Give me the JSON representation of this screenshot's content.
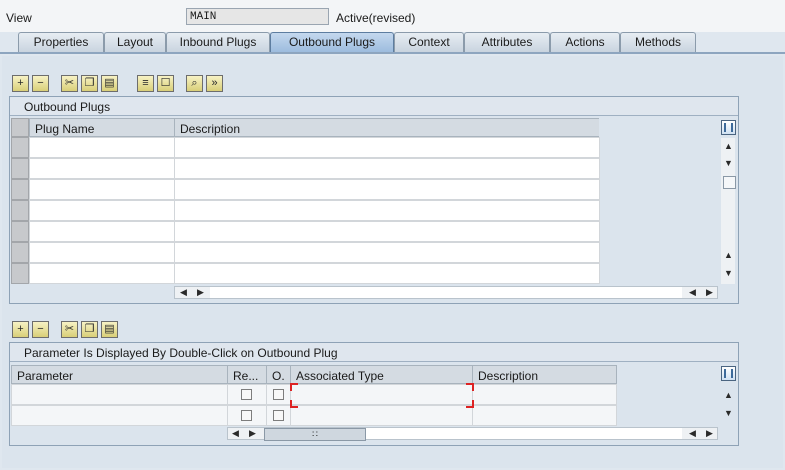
{
  "header": {
    "view_label": "View",
    "view_value": "MAIN",
    "status": "Active(revised)"
  },
  "tabs": [
    {
      "label": "Properties"
    },
    {
      "label": "Layout"
    },
    {
      "label": "Inbound Plugs"
    },
    {
      "label": "Outbound Plugs",
      "active": true
    },
    {
      "label": "Context"
    },
    {
      "label": "Attributes"
    },
    {
      "label": "Actions"
    },
    {
      "label": "Methods"
    }
  ],
  "outbound_table": {
    "title": "Outbound Plugs",
    "columns": [
      "Plug Name",
      "Description"
    ],
    "rows": [
      [
        "",
        ""
      ],
      [
        "",
        ""
      ],
      [
        "",
        ""
      ],
      [
        "",
        ""
      ],
      [
        "",
        ""
      ],
      [
        "",
        ""
      ],
      [
        "",
        ""
      ]
    ]
  },
  "parameter_table": {
    "title": "Parameter Is Displayed By Double-Click on Outbound Plug",
    "columns": [
      "Parameter",
      "Re...",
      "O.",
      "Associated Type",
      "Description"
    ],
    "rows": [
      [
        "",
        "",
        "",
        "",
        ""
      ],
      [
        "",
        "",
        "",
        "",
        ""
      ]
    ]
  },
  "scroll": {
    "up": "▲",
    "down": "▼",
    "left": "◀",
    "right": "▶",
    "grip": "∷"
  }
}
